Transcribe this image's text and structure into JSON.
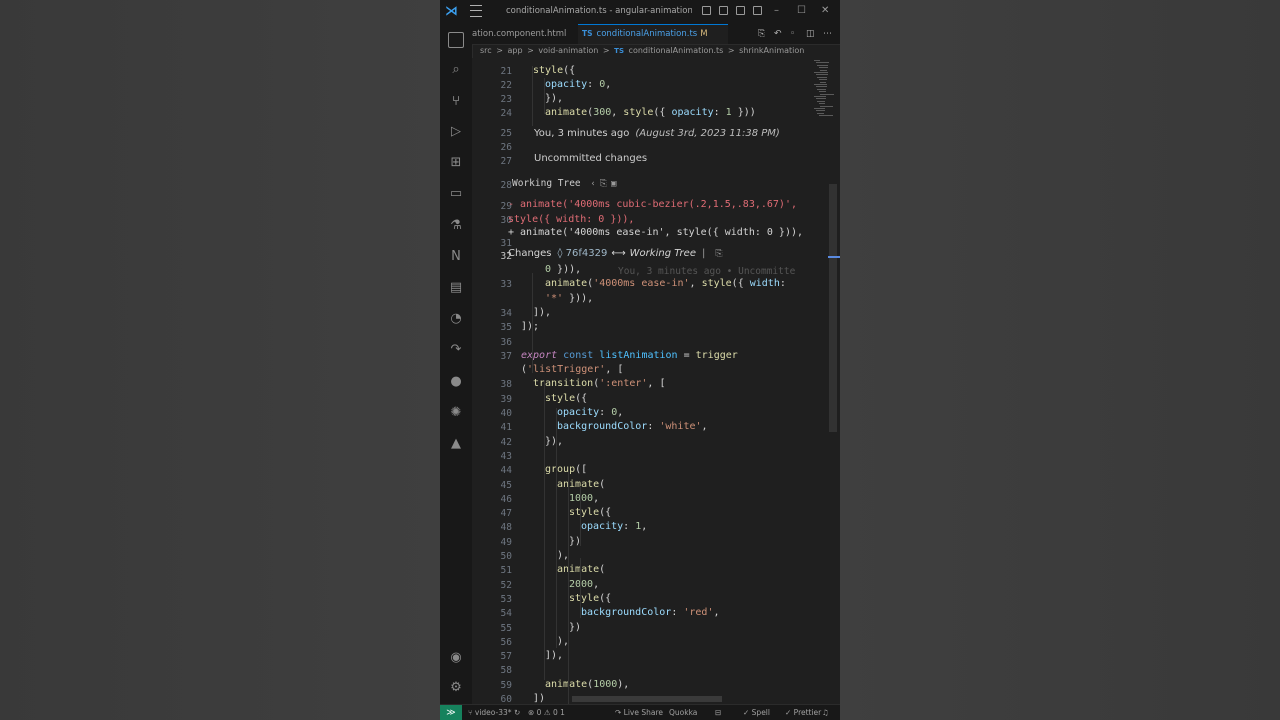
{
  "window": {
    "title": "conditionalAnimation.ts - angular-animations - Visu..."
  },
  "tabs": [
    {
      "label": "ation.component.html"
    },
    {
      "badge": "TS",
      "label": "conditionalAnimation.ts",
      "modified": "M"
    }
  ],
  "breadcrumb": [
    "src",
    ">",
    "app",
    ">",
    "void-animation",
    ">",
    "TS",
    "conditionalAnimation.ts",
    ">",
    "shrinkAnimation"
  ],
  "blame": {
    "who_time": "You, 3 minutes ago",
    "date": "(August 3rd, 2023 11:38 PM)",
    "uncommitted": "Uncommitted changes",
    "working_tree": "Working Tree"
  },
  "diff": {
    "removed": "- animate('4000ms cubic-bezier(.2,1.5,.83,.67)',\nstyle({ width: 0 })),",
    "added": "+ animate('4000ms ease-in', style({ width: 0 })),"
  },
  "changes_bar": {
    "label": "Changes",
    "sha": "76f4329",
    "arrow": "⟷",
    "target": "Working Tree",
    "sep": "|"
  },
  "ghost_blame": "You, 3 minutes ago • Uncommitte",
  "editor": {
    "top_lines": [
      {
        "n": "21",
        "t": "  style({"
      },
      {
        "n": "22",
        "t": "    opacity: 0,"
      },
      {
        "n": "23",
        "t": "  }),"
      },
      {
        "n": "24",
        "t": "  animate(300, style({ opacity: 1 }))"
      }
    ],
    "gap_lines": [
      "25",
      "26",
      "27",
      "28",
      "29",
      "30",
      "31",
      "32"
    ],
    "working_tree_line": "28",
    "changes_line": "32",
    "lines": [
      {
        "n": "",
        "t": "0 })),"
      },
      {
        "n": "33",
        "t": "animate('4000ms ease-in', style({ width:"
      },
      {
        "n": "",
        "t": "'*' })),"
      },
      {
        "n": "34",
        "t": "]),"
      },
      {
        "n": "35",
        "t": "]);"
      },
      {
        "n": "36",
        "t": ""
      },
      {
        "n": "37",
        "t": "export const listAnimation = trigger"
      },
      {
        "n": "",
        "t": "('listTrigger', ["
      },
      {
        "n": "38",
        "t": "transition(':enter', ["
      },
      {
        "n": "39",
        "t": "style({"
      },
      {
        "n": "40",
        "t": "opacity: 0,"
      },
      {
        "n": "41",
        "t": "backgroundColor: 'white',"
      },
      {
        "n": "42",
        "t": "}),"
      },
      {
        "n": "43",
        "t": ""
      },
      {
        "n": "44",
        "t": "group(["
      },
      {
        "n": "45",
        "t": "animate("
      },
      {
        "n": "46",
        "t": "1000,"
      },
      {
        "n": "47",
        "t": "style({"
      },
      {
        "n": "48",
        "t": "opacity: 1,"
      },
      {
        "n": "49",
        "t": "})"
      },
      {
        "n": "50",
        "t": "),"
      },
      {
        "n": "51",
        "t": "animate("
      },
      {
        "n": "52",
        "t": "2000,"
      },
      {
        "n": "53",
        "t": "style({"
      },
      {
        "n": "54",
        "t": "backgroundColor: 'red',"
      },
      {
        "n": "55",
        "t": "})"
      },
      {
        "n": "56",
        "t": "),"
      },
      {
        "n": "57",
        "t": "]),"
      },
      {
        "n": "58",
        "t": ""
      },
      {
        "n": "59",
        "t": "animate(1000),"
      },
      {
        "n": "60",
        "t": "])"
      }
    ]
  },
  "statusbar": {
    "remote": "≫",
    "branch": "video-33*",
    "sync": "↻",
    "errors": "⊗ 0",
    "warnings": "⚠ 0",
    "info": "1",
    "liveshare": "Live Share",
    "quokka": "Quokka",
    "spell": "Spell",
    "prettier": "Prettier"
  },
  "colors": {
    "editor_bg": "#1f1f1f",
    "accent": "#0078d4",
    "removed": "#e06c75",
    "remote_bg": "#16825d"
  },
  "icons": {
    "activity": [
      "explorer-icon",
      "search-icon",
      "source-control-icon",
      "run-debug-icon",
      "extensions-icon",
      "remote-explorer-icon",
      "testing-icon",
      "nx-console-icon",
      "copilot-icon",
      "timeline-icon",
      "live-share-icon",
      "github-icon",
      "gitlens-icon",
      "docker-icon",
      "accounts-icon",
      "settings-gear-icon"
    ]
  }
}
